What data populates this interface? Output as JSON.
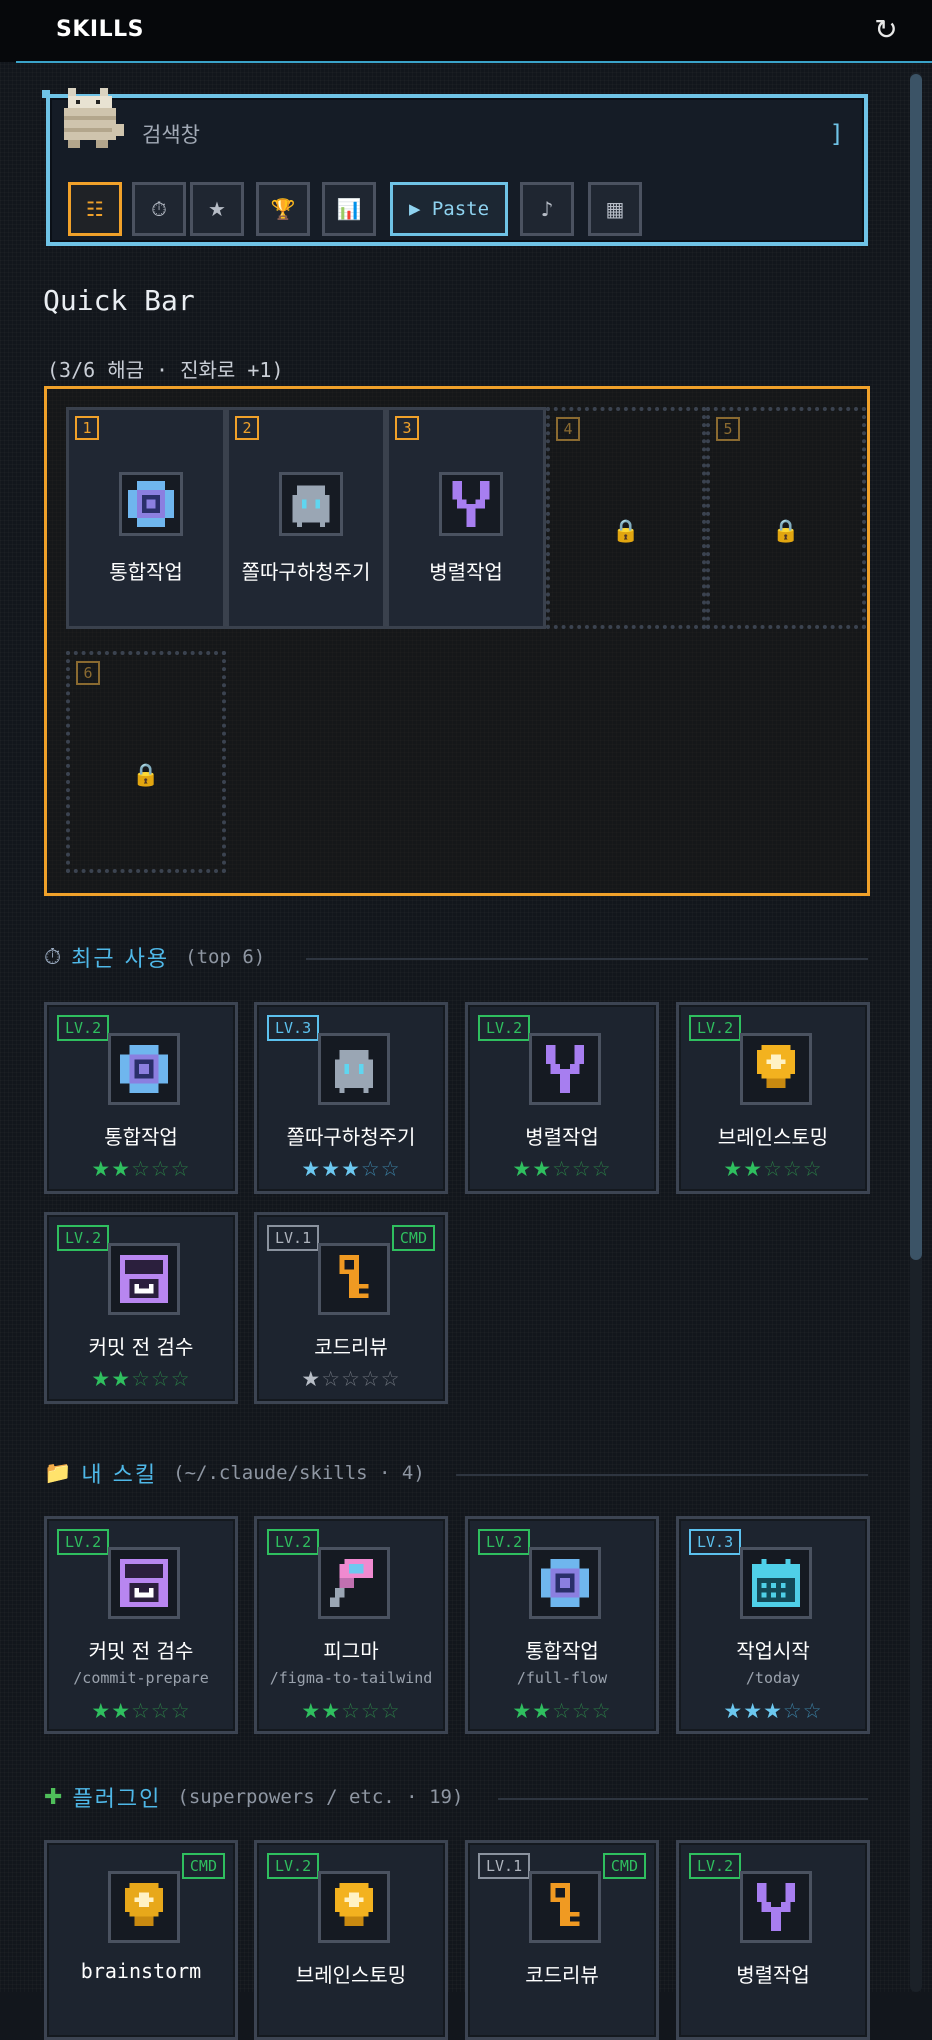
{
  "header": {
    "title": "SKILLS",
    "refresh_icon": "refresh-icon"
  },
  "search": {
    "placeholder": "검색창",
    "bracket": "]",
    "tools": [
      {
        "name": "list-icon",
        "glyph": "☷",
        "active": true
      },
      {
        "name": "timer-icon",
        "glyph": "⏱",
        "active": false
      },
      {
        "name": "star-icon",
        "glyph": "★",
        "active": false
      },
      {
        "name": "trophy-icon",
        "glyph": "🏆",
        "active": false
      },
      {
        "name": "chart-icon",
        "glyph": "📊",
        "active": false
      }
    ],
    "paste_label": "▶ Paste",
    "tools_after": [
      {
        "name": "music-icon",
        "glyph": "♪"
      },
      {
        "name": "grid-icon",
        "glyph": "▦"
      }
    ]
  },
  "quickbar": {
    "title": "Quick Bar",
    "subtitle": "(3/6 해금 · 진화로 +1)",
    "slots": [
      {
        "num": "1",
        "label": "통합작업",
        "icon": "orbit-icon",
        "locked": false
      },
      {
        "num": "2",
        "label": "쫄따구하청주기",
        "icon": "ghost-icon",
        "locked": false
      },
      {
        "num": "3",
        "label": "병렬작업",
        "icon": "fork-icon",
        "locked": false
      },
      {
        "num": "4",
        "label": "",
        "icon": "lock-icon",
        "locked": true
      },
      {
        "num": "5",
        "label": "",
        "icon": "lock-icon",
        "locked": true
      },
      {
        "num": "6",
        "label": "",
        "icon": "lock-icon",
        "locked": true
      }
    ]
  },
  "recent": {
    "title": "최근 사용",
    "subtitle": "(top 6)",
    "icon": "stopwatch-icon",
    "cards": [
      {
        "level": "LV.2",
        "label": "통합작업",
        "icon": "orbit-icon",
        "stars": 2,
        "tone": "g"
      },
      {
        "level": "LV.3",
        "label": "쫄따구하청주기",
        "icon": "ghost-icon",
        "stars": 3,
        "tone": "b"
      },
      {
        "level": "LV.2",
        "label": "병렬작업",
        "icon": "fork-icon",
        "stars": 2,
        "tone": "g"
      },
      {
        "level": "LV.2",
        "label": "브레인스토밍",
        "icon": "bulb-icon",
        "stars": 2,
        "tone": "g"
      },
      {
        "level": "LV.2",
        "label": "커밋 전 검수",
        "icon": "inbox-icon",
        "stars": 2,
        "tone": "g"
      },
      {
        "level": "LV.1",
        "label": "코드리뷰",
        "icon": "key-icon",
        "stars": 1,
        "tone": "w",
        "cmd": "CMD"
      }
    ]
  },
  "my_skills": {
    "title": "내 스킬",
    "subtitle": "(~/.claude/skills · 4)",
    "icon": "folder-icon",
    "cards": [
      {
        "level": "LV.2",
        "label": "커밋 전 검수",
        "path": "/commit-prepare",
        "icon": "inbox-icon",
        "stars": 2,
        "tone": "g"
      },
      {
        "level": "LV.2",
        "label": "피그마",
        "path": "/figma-to-tailwind",
        "icon": "brush-icon",
        "stars": 2,
        "tone": "g"
      },
      {
        "level": "LV.2",
        "label": "통합작업",
        "path": "/full-flow",
        "icon": "orbit-icon",
        "stars": 2,
        "tone": "g"
      },
      {
        "level": "LV.3",
        "label": "작업시작",
        "path": "/today",
        "icon": "calendar-icon",
        "stars": 3,
        "tone": "b"
      }
    ]
  },
  "plugins": {
    "title": "플러그인",
    "subtitle": "(superpowers / etc. · 19)",
    "icon": "puzzle-icon",
    "cards": [
      {
        "level": "",
        "label": "brainstorm",
        "icon": "bulb-icon",
        "cmd": "CMD"
      },
      {
        "level": "LV.2",
        "label": "브레인스토밍",
        "icon": "bulb-icon"
      },
      {
        "level": "LV.1",
        "label": "코드리뷰",
        "icon": "key-icon",
        "cmd": "CMD"
      },
      {
        "level": "LV.2",
        "label": "병렬작업",
        "icon": "fork-icon"
      }
    ]
  }
}
